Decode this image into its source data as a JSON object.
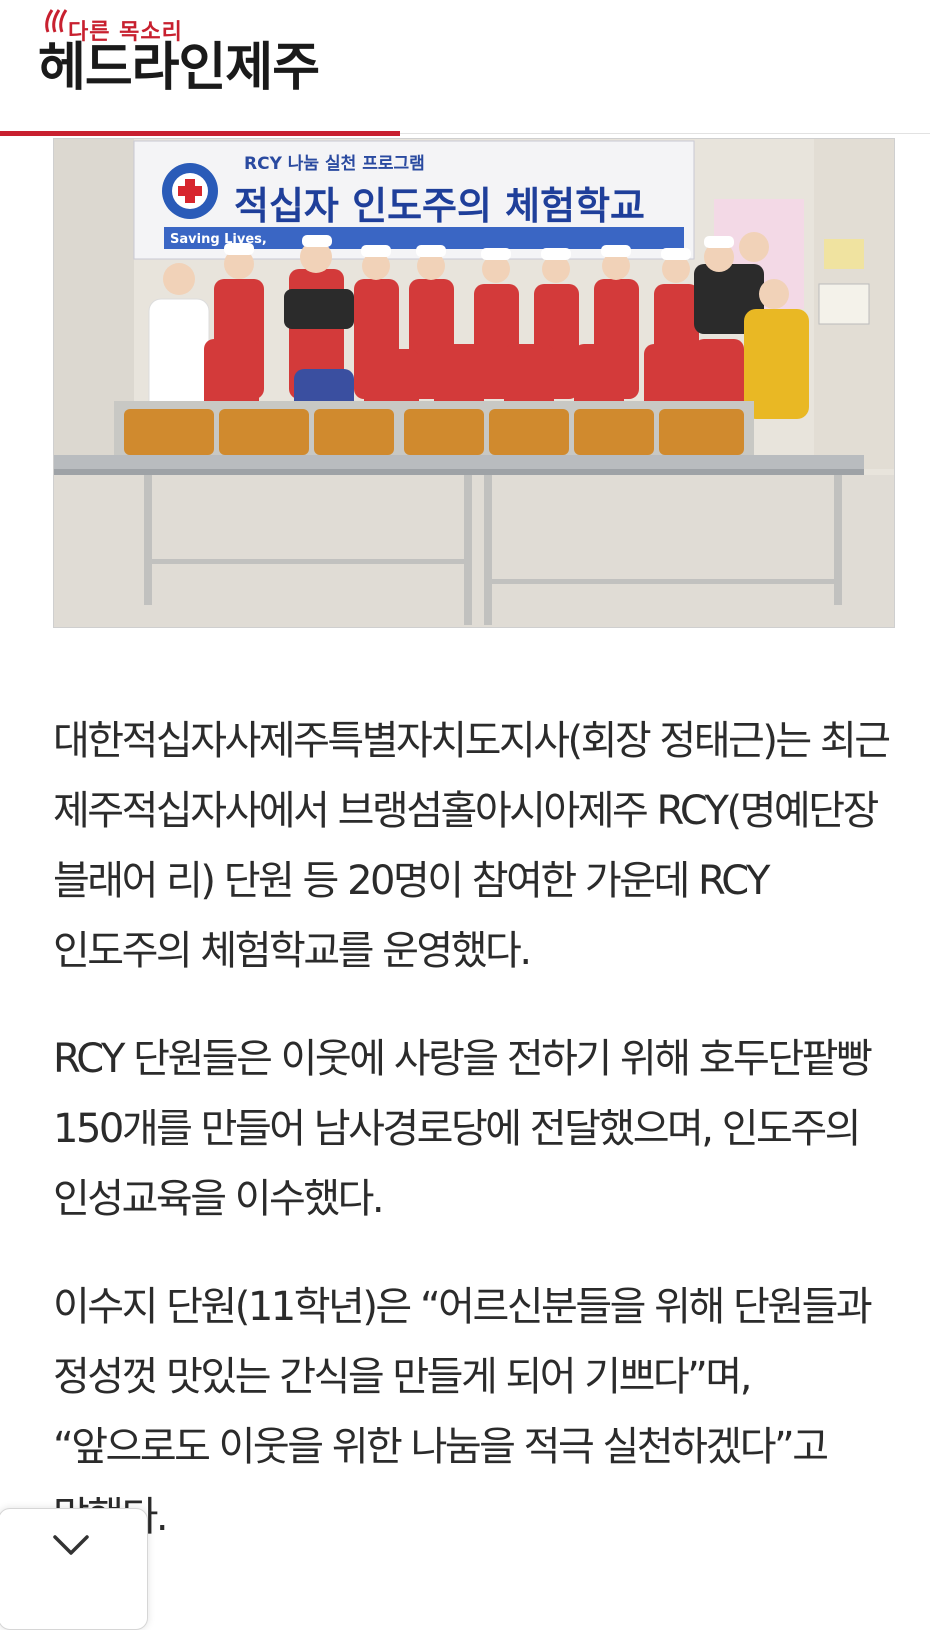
{
  "header": {
    "tagline": "다른 목소리",
    "site_name": "헤드라인제주",
    "accent_color": "#c8202f"
  },
  "photo": {
    "banner_small": "RCY 나눔 실천 프로그램",
    "banner_title": "적십자 인도주의 체험학교",
    "banner_slogan": "Saving Lives,"
  },
  "article": {
    "paragraphs": [
      "대한적십자사제주특별자치도지사(회장 정태근)는 최근 제주적십자사에서 브랭섬홀아시아제주 RCY(명예단장 블래어 리) 단원 등 20명이 참여한 가운데 RCY 인도주의 체험학교를 운영했다.",
      "RCY 단원들은 이웃에 사랑을 전하기 위해 호두단팥빵 150개를 만들어 남사경로당에 전달했으며, 인도주의 인성교육을 이수했다.",
      "이수지 단원(11학년)은 “어르신분들을 위해 단원들과 정성껏 맛있는 간식을 만들게 되어 기쁘다”며, “앞으로도 이웃을 위한 나눔을 적극 실천하겠다”고 말했다."
    ]
  },
  "controls": {
    "scroll_icon": "chevron-down-icon"
  }
}
